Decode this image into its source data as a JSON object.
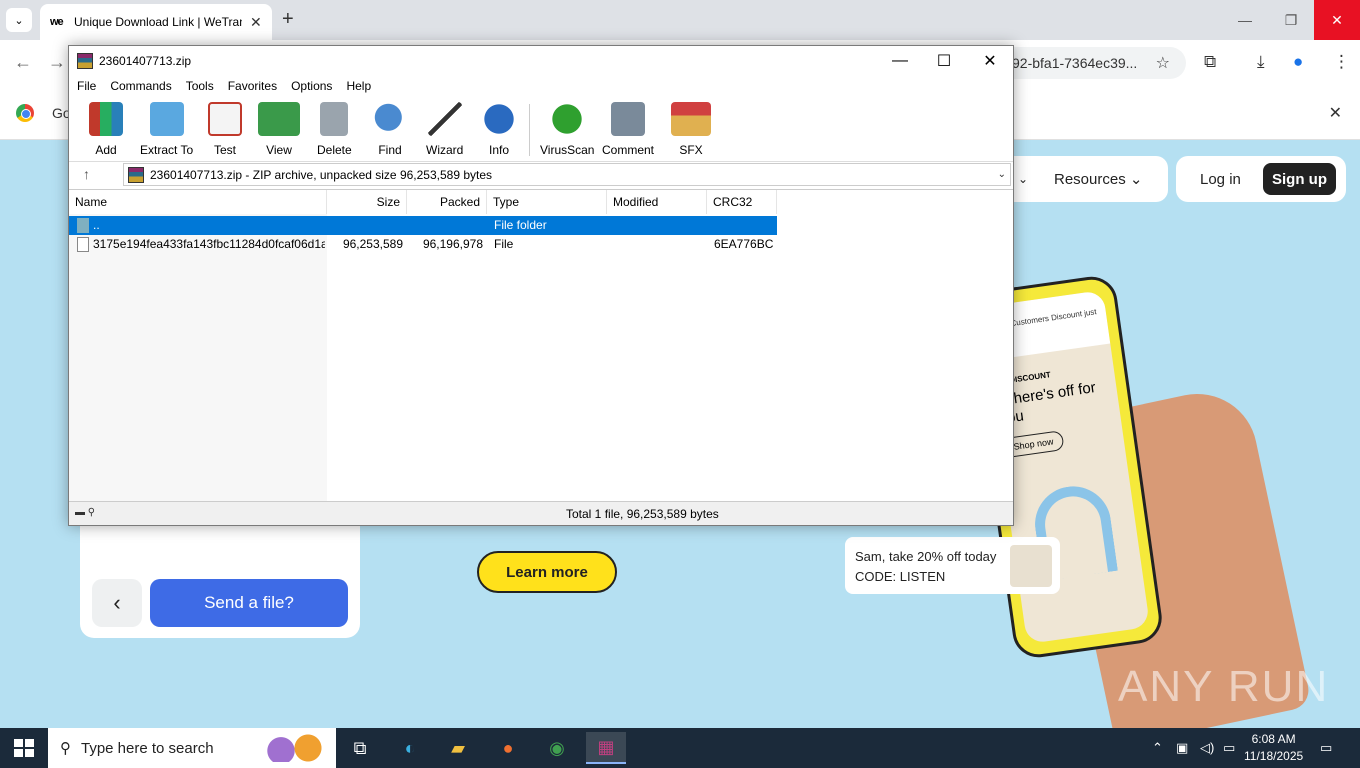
{
  "browser": {
    "tab_title": "Unique Download Link | WeTransfer",
    "tab_favicon": "we",
    "url_fragment": "92-bfa1-7364ec39...",
    "infobar_text": "Go",
    "window_controls": {
      "minimize": "—",
      "restore": "❐",
      "close": "✕"
    }
  },
  "webpage": {
    "nav_resources": "Resources",
    "login": "Log in",
    "signup": "Sign up",
    "send_button": "Send a file?",
    "learn_more": "Learn more",
    "toast_line1": "Sam, take 20% off today",
    "toast_line2": "CODE: LISTEN",
    "phone_top": "Value Customers Discount just for you",
    "phone_label": "VE DISCOUNT",
    "phone_headline": "n, here's off for you",
    "phone_button": "Shop now",
    "watermark": "ANY RUN"
  },
  "winrar": {
    "title": "23601407713.zip",
    "menu": [
      "File",
      "Commands",
      "Tools",
      "Favorites",
      "Options",
      "Help"
    ],
    "toolbar": [
      "Add",
      "Extract To",
      "Test",
      "View",
      "Delete",
      "Find",
      "Wizard",
      "Info",
      "VirusScan",
      "Comment",
      "SFX"
    ],
    "path": "23601407713.zip - ZIP archive, unpacked size 96,253,589 bytes",
    "columns": [
      "Name",
      "Size",
      "Packed",
      "Type",
      "Modified",
      "CRC32"
    ],
    "rows": [
      {
        "name": "..",
        "size": "",
        "packed": "",
        "type": "File folder",
        "modified": "",
        "crc": ""
      },
      {
        "name": "3175e194fea433fa143fbc11284d0fcaf06d1a...",
        "size": "96,253,589",
        "packed": "96,196,978",
        "type": "File",
        "modified": "",
        "crc": "6EA776BC"
      }
    ],
    "status": "Total 1 file, 96,253,589 bytes"
  },
  "taskbar": {
    "search_placeholder": "Type here to search",
    "time": "6:08 AM",
    "date": "11/18/2025"
  },
  "colors": {
    "page_bg": "#b5e0f2",
    "selection": "#0078d7",
    "send_btn": "#3e6be6",
    "learn_btn": "#ffe11b",
    "taskbar": "#1b2a3a"
  }
}
